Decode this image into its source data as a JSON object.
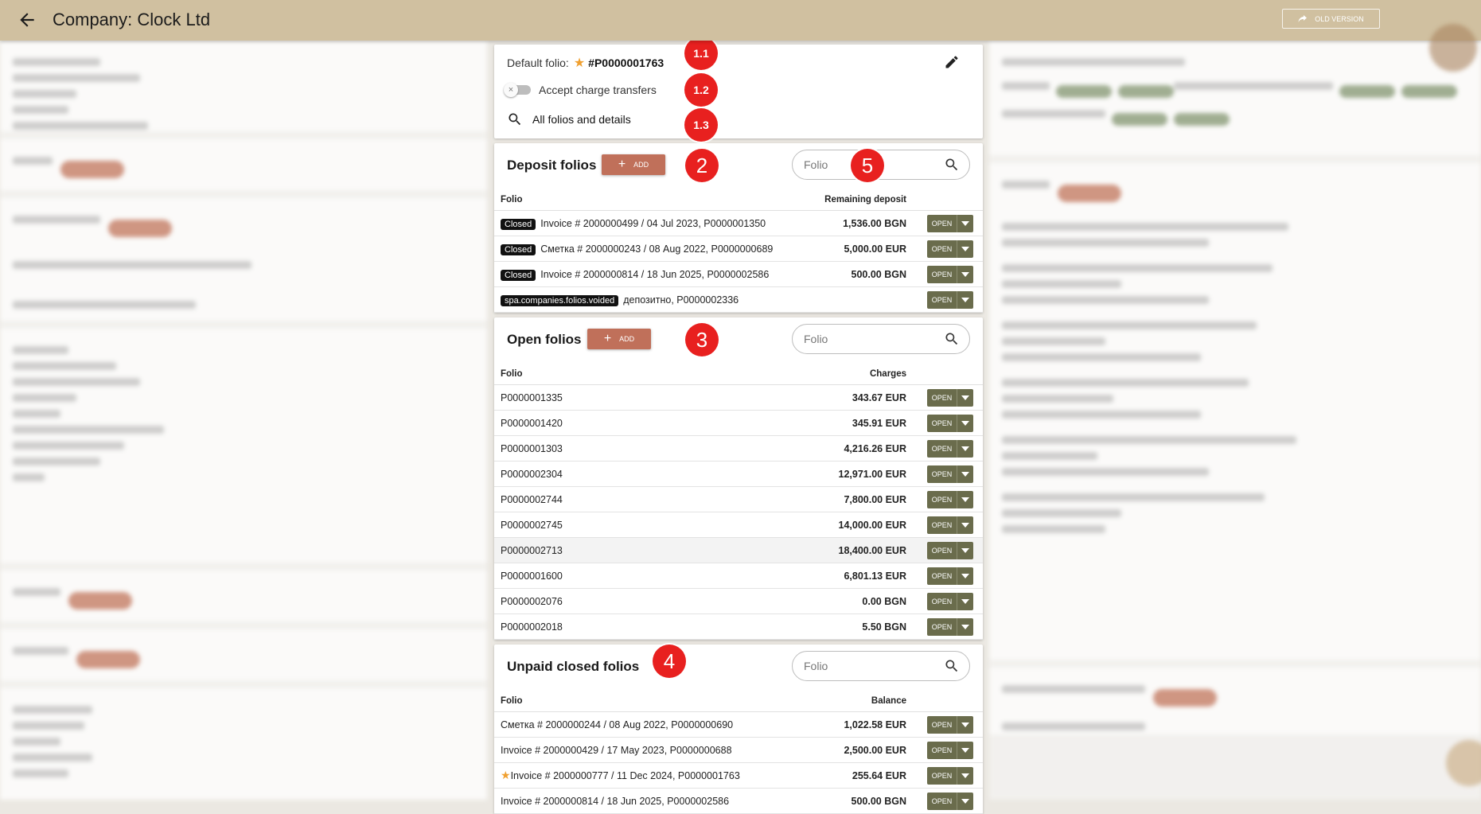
{
  "header": {
    "title": "Company: Clock Ltd",
    "old_version_label": "OLD VERSION"
  },
  "default_card": {
    "default_folio_label": "Default folio:",
    "default_folio_value": "#P0000001763",
    "accept_transfers_label": "Accept charge transfers",
    "all_folios_label": "All folios and details"
  },
  "markers": {
    "m11": "1.1",
    "m12": "1.2",
    "m13": "1.3",
    "m2": "2",
    "m3": "3",
    "m4": "4",
    "m5": "5"
  },
  "open_label": "OPEN",
  "add_label": "ADD",
  "search_placeholder": "Folio",
  "deposit": {
    "title": "Deposit folios",
    "col_folio": "Folio",
    "col_amount": "Remaining deposit",
    "rows": [
      {
        "tag": "Closed",
        "text": "Invoice  # 2000000499 / 04 Jul 2023, P0000001350",
        "amount": "1,536.00 BGN"
      },
      {
        "tag": "Closed",
        "text": "Сметка  # 2000000243 / 08 Aug 2022, P0000000689",
        "amount": "5,000.00 EUR"
      },
      {
        "tag": "Closed",
        "text": "Invoice  # 2000000814 / 18 Jun 2025, P0000002586",
        "amount": "500.00 BGN"
      },
      {
        "tag": "spa.companies.folios.voided",
        "text": "депозитно,  P0000002336",
        "amount": ""
      }
    ]
  },
  "open_folios": {
    "title": "Open folios",
    "col_folio": "Folio",
    "col_amount": "Charges",
    "rows": [
      {
        "text": "P0000001335",
        "amount": "343.67 EUR"
      },
      {
        "text": "P0000001420",
        "amount": "345.91 EUR"
      },
      {
        "text": "P0000001303",
        "amount": "4,216.26 EUR"
      },
      {
        "text": "P0000002304",
        "amount": "12,971.00 EUR"
      },
      {
        "text": "P0000002744",
        "amount": "7,800.00 EUR"
      },
      {
        "text": "P0000002745",
        "amount": "14,000.00 EUR"
      },
      {
        "text": "P0000002713",
        "amount": "18,400.00 EUR"
      },
      {
        "text": "P0000001600",
        "amount": "6,801.13 EUR"
      },
      {
        "text": "P0000002076",
        "amount": "0.00 BGN"
      },
      {
        "text": "P0000002018",
        "amount": "5.50 BGN"
      }
    ]
  },
  "unpaid": {
    "title": "Unpaid closed folios",
    "col_folio": "Folio",
    "col_amount": "Balance",
    "rows": [
      {
        "text": "Сметка  # 2000000244 / 08 Aug 2022, P0000000690",
        "amount": "1,022.58 EUR",
        "starred": false
      },
      {
        "text": "Invoice  # 2000000429 / 17 May 2023, P0000000688",
        "amount": "2,500.00 EUR",
        "starred": false
      },
      {
        "text": "Invoice  # 2000000777 / 11 Dec 2024, P0000001763",
        "amount": "255.64 EUR",
        "starred": true
      },
      {
        "text": "Invoice  # 2000000814 / 18 Jun 2025, P0000002586",
        "amount": "500.00 BGN",
        "starred": false
      }
    ]
  },
  "colors": {
    "header": "#d0c0a0",
    "accent": "#c0705a",
    "open_button": "#6a6c4c",
    "marker": "#e8201f"
  }
}
